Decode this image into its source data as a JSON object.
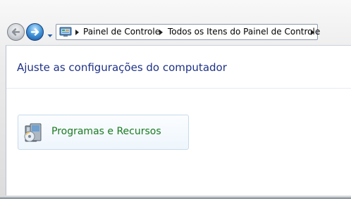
{
  "navigation": {
    "back_icon": "back-arrow-icon",
    "forward_icon": "forward-arrow-icon",
    "recent_pages_icon": "chevron-down-icon"
  },
  "address_bar": {
    "icon": "control-panel-icon",
    "breadcrumbs": [
      {
        "label": "Painel de Controle"
      },
      {
        "label": "Todos os Itens do Painel de Controle"
      }
    ]
  },
  "main": {
    "heading": "Ajuste as configurações do computador",
    "items": [
      {
        "label": "Programas e Recursos",
        "icon": "programs-features-icon"
      }
    ]
  },
  "colors": {
    "heading": "#1e3287",
    "item_label": "#1a7a21",
    "forward_button": "#3f93d8"
  }
}
